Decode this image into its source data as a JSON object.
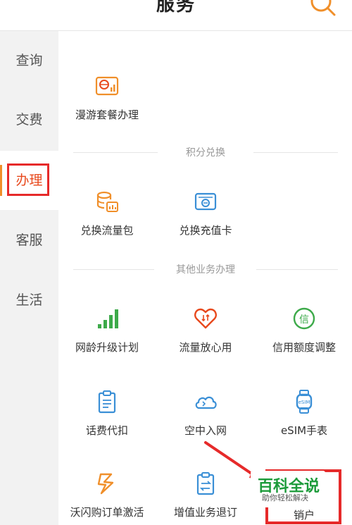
{
  "header": {
    "title": "服务"
  },
  "sidebar": {
    "items": [
      {
        "label": "查询"
      },
      {
        "label": "交费"
      },
      {
        "label": "办理"
      },
      {
        "label": "客服"
      },
      {
        "label": "生活"
      }
    ]
  },
  "sections": {
    "top": {
      "items": [
        {
          "label": "漫游套餐办理",
          "icon": "roaming-package-icon"
        }
      ]
    },
    "points": {
      "title": "积分兑换",
      "items": [
        {
          "label": "兑换流量包",
          "icon": "data-coins-icon"
        },
        {
          "label": "兑换充值卡",
          "icon": "recharge-card-icon"
        }
      ]
    },
    "other": {
      "title": "其他业务办理",
      "items": [
        {
          "label": "网龄升级计划",
          "icon": "signal-bars-icon"
        },
        {
          "label": "流量放心用",
          "icon": "heart-data-icon"
        },
        {
          "label": "信用额度调整",
          "icon": "credit-icon"
        },
        {
          "label": "话费代扣",
          "icon": "clipboard-bill-icon"
        },
        {
          "label": "空中入网",
          "icon": "cloud-icon"
        },
        {
          "label": "eSIM手表",
          "icon": "watch-icon"
        },
        {
          "label": "沃闪购订单激活",
          "icon": "lightning-icon"
        },
        {
          "label": "增值业务退订",
          "icon": "unsubscribe-icon"
        },
        {
          "label": "销户",
          "icon": "close-account-icon"
        }
      ]
    }
  },
  "watermark": {
    "brand": "百科全说",
    "tagline": "助你轻松解决"
  },
  "colors": {
    "accent": "#e8491d",
    "highlight": "#e62a2a",
    "orange": "#f08f2a",
    "green": "#3daa4a",
    "blue": "#3a8fd6"
  }
}
